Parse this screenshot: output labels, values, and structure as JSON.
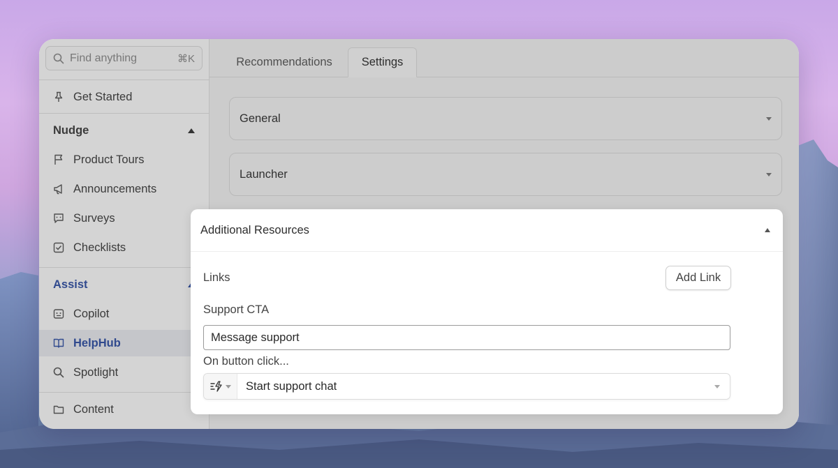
{
  "sidebar": {
    "search": {
      "placeholder": "Find anything",
      "shortcut": "⌘K"
    },
    "get_started": {
      "label": "Get Started",
      "icon": "pin-icon"
    },
    "nudge": {
      "label": "Nudge",
      "items": [
        {
          "label": "Product Tours",
          "icon": "flag-icon"
        },
        {
          "label": "Announcements",
          "icon": "megaphone-icon"
        },
        {
          "label": "Surveys",
          "icon": "chat-bubble-icon"
        },
        {
          "label": "Checklists",
          "icon": "checkbox-icon"
        }
      ]
    },
    "assist": {
      "label": "Assist",
      "items": [
        {
          "label": "Copilot",
          "icon": "robot-icon"
        },
        {
          "label": "HelpHub",
          "icon": "book-icon",
          "active": true
        },
        {
          "label": "Spotlight",
          "icon": "search-icon"
        }
      ]
    },
    "content": {
      "label": "Content",
      "icon": "folder-icon"
    }
  },
  "main": {
    "tabs": [
      {
        "label": "Recommendations",
        "active": false
      },
      {
        "label": "Settings",
        "active": true
      }
    ],
    "sections": {
      "general": {
        "label": "General"
      },
      "launcher": {
        "label": "Launcher"
      },
      "additional": {
        "label": "Additional Resources",
        "links_label": "Links",
        "add_link_label": "Add Link",
        "support_cta_label": "Support CTA",
        "support_cta_value": "Message support",
        "on_click_label": "On button click...",
        "on_click_value": "Start support chat"
      }
    }
  },
  "colors": {
    "accent": "#2f4fa6",
    "active_bg": "#eceef2"
  }
}
